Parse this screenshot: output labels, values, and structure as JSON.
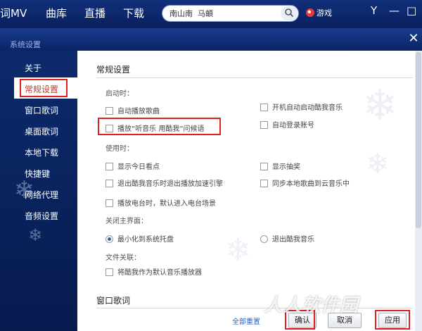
{
  "top_nav": {
    "items": [
      "词MV",
      "曲库",
      "直播",
      "下载"
    ],
    "search": {
      "value": "南山南  马頔"
    },
    "game_label": "游戏"
  },
  "dialog": {
    "title": "系统设置",
    "sidebar": [
      "关于",
      "常规设置",
      "窗口歌词",
      "桌面歌词",
      "本地下载",
      "快捷键",
      "网络代理",
      "音频设置"
    ],
    "selected": "常规设置",
    "section_general": "常规设置",
    "startup_label": "启动时：",
    "startup_options": [
      {
        "label": "自动播放歌曲",
        "checked": false
      },
      {
        "label": "开机自动启动酷我音乐",
        "checked": false
      },
      {
        "label": "播放“听音乐 用酷我”问候语",
        "checked": false
      },
      {
        "label": "自动登录账号",
        "checked": false
      }
    ],
    "use_label": "使用时：",
    "use_options": [
      {
        "label": "显示今日看点",
        "checked": false
      },
      {
        "label": "显示抽奖",
        "checked": false
      },
      {
        "label": "退出酷我音乐时退出播放加速引擎",
        "checked": false
      },
      {
        "label": "同步本地歌曲到云音乐中",
        "checked": false
      },
      {
        "label": "播放电台时，默认进入电台场景",
        "checked": false
      }
    ],
    "close_label": "关闭主界面：",
    "close_options": [
      {
        "label": "最小化到系统托盘",
        "checked": true
      },
      {
        "label": "退出酷我音乐",
        "checked": false
      }
    ],
    "file_label": "文件关联：",
    "file_options": [
      {
        "label": "将酷我作为默认音乐播放器",
        "checked": false
      }
    ],
    "section_lyrics": "窗口歌词",
    "reset_label": "全部重置",
    "buttons": {
      "ok": "确认",
      "cancel": "取消",
      "apply": "应用"
    }
  },
  "watermark": "人人软件园",
  "colors": {
    "highlight": "#e02020",
    "nav_bg": "#0a1f5e",
    "link": "#2a63c8"
  }
}
